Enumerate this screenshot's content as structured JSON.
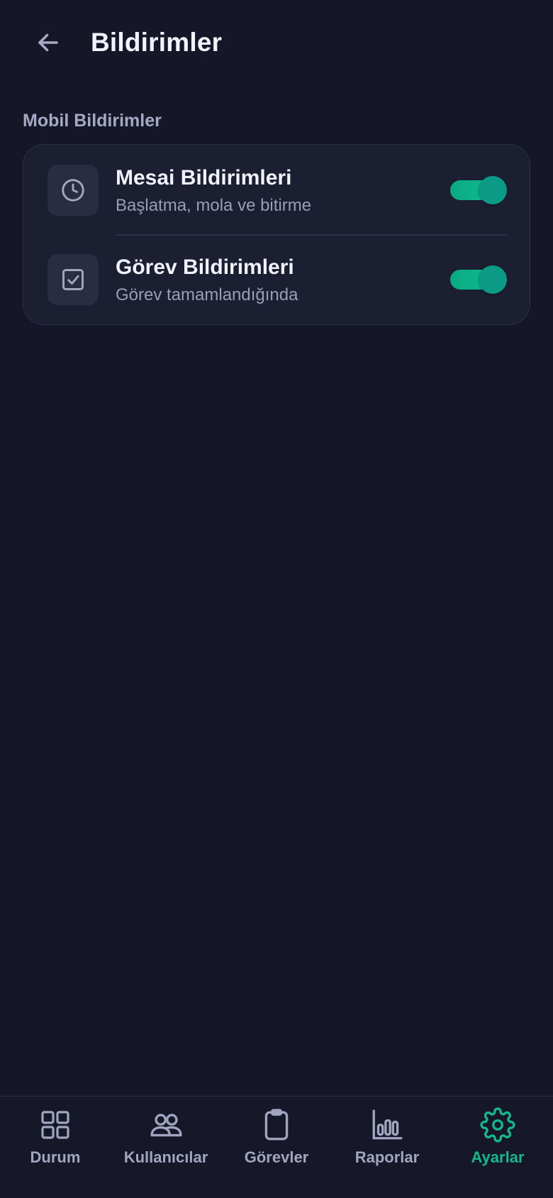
{
  "header": {
    "title": "Bildirimler",
    "back_icon": "arrow-left-icon"
  },
  "section": {
    "label": "Mobil Bildirimler",
    "items": [
      {
        "title": "Mesai Bildirimleri",
        "subtitle": "Başlatma, mola ve bitirme",
        "icon": "clock-icon",
        "enabled": true
      },
      {
        "title": "Görev Bildirimleri",
        "subtitle": "Görev tamamlandığında",
        "icon": "checkbox-icon",
        "enabled": true
      }
    ]
  },
  "bottom_nav": {
    "items": [
      {
        "label": "Durum",
        "icon": "grid-icon",
        "active": false
      },
      {
        "label": "Kullanıcılar",
        "icon": "users-icon",
        "active": false
      },
      {
        "label": "Görevler",
        "icon": "clipboard-icon",
        "active": false
      },
      {
        "label": "Raporlar",
        "icon": "bar-chart-icon",
        "active": false
      },
      {
        "label": "Ayarlar",
        "icon": "gear-icon",
        "active": true
      }
    ]
  },
  "colors": {
    "background": "#151728",
    "card": "#1c1e31",
    "accent": "#12b98b",
    "text_primary": "#f1f2fb",
    "text_secondary": "#9a9db8"
  }
}
